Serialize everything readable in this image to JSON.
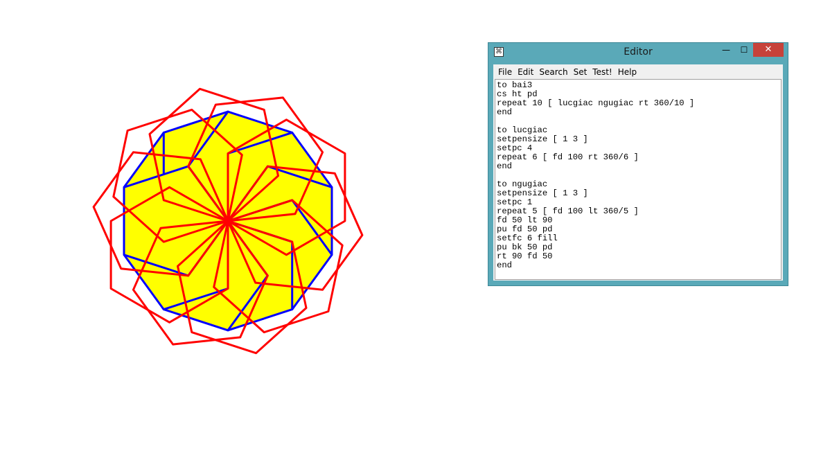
{
  "drawing": {
    "fill_color": "#ffff00",
    "pentagon_stroke": "#0000ff",
    "hexagon_stroke": "#ff0000",
    "background": "#ffffff"
  },
  "editor": {
    "title": "Editor",
    "icon": "logo-app-icon",
    "buttons": {
      "minimize": "—",
      "maximize": "☐",
      "close": "✕"
    },
    "menu": [
      "File",
      "Edit",
      "Search",
      "Set",
      "Test!",
      "Help"
    ],
    "code": "to bai3\ncs ht pd\nrepeat 10 [ lucgiac ngugiac rt 360/10 ]\nend\n\nto lucgiac\nsetpensize [ 1 3 ]\nsetpc 4\nrepeat 6 [ fd 100 rt 360/6 ]\nend\n\nto ngugiac\nsetpensize [ 1 3 ]\nsetpc 1\nrepeat 5 [ fd 100 lt 360/5 ]\nfd 50 lt 90\npu fd 50 pd\nsetfc 6 fill\npu bk 50 pd\nrt 90 fd 50\nend"
  }
}
